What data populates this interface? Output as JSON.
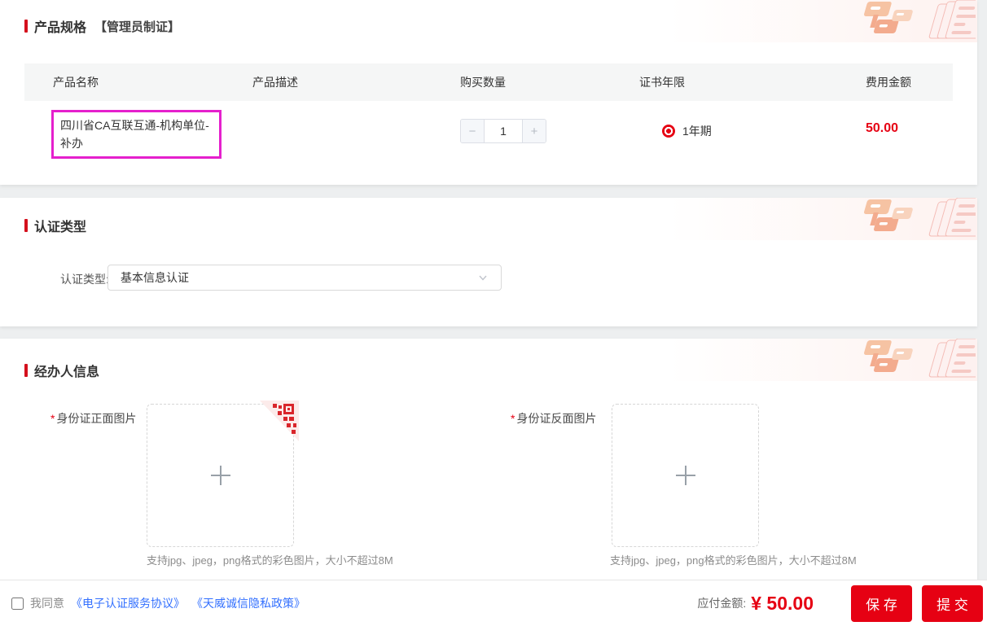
{
  "colors": {
    "accent_red": "#e60113",
    "title_bar_red": "#d4101d",
    "highlight_magenta": "#e520cd",
    "link_blue": "#3370ff",
    "table_header_bg": "#f5f6f6"
  },
  "icons": {
    "minus-icon": "−",
    "plus-icon": "+",
    "chevron-down-icon": "⌄",
    "qr-scan-icon": "qr-code",
    "upload-plus-icon": "+"
  },
  "product_section": {
    "title": "产品规格",
    "subtitle": "【管理员制证】",
    "table": {
      "headers": [
        "产品名称",
        "产品描述",
        "购买数量",
        "证书年限",
        "费用金额"
      ],
      "row": {
        "name": "四川省CA互联互通-机构单位-补办",
        "description": "",
        "quantity": "1",
        "minus_label": "−",
        "plus_label": "+",
        "validity_option": "1年期",
        "validity_selected": true,
        "price": "50.00"
      }
    }
  },
  "auth_section": {
    "title": "认证类型",
    "field_label": "认证类型:",
    "selected_value": "基本信息认证"
  },
  "agent_section": {
    "title": "经办人信息",
    "fields": [
      {
        "required_mark": "*",
        "label": "身份证正面图片",
        "hint": "支持jpg、jpeg，png格式的彩色图片，大小不超过8M",
        "has_qr_badge": true
      },
      {
        "required_mark": "*",
        "label": "身份证反面图片",
        "hint": "支持jpg、jpeg，png格式的彩色图片，大小不超过8M",
        "has_qr_badge": false
      }
    ]
  },
  "footer": {
    "agree_text": "我同意",
    "links": [
      "《电子认证服务协议》",
      "《天威诚信隐私政策》"
    ],
    "payable_label": "应付金额:",
    "payable_amount": "¥ 50.00",
    "save_button": "保 存",
    "submit_button": "提 交"
  }
}
